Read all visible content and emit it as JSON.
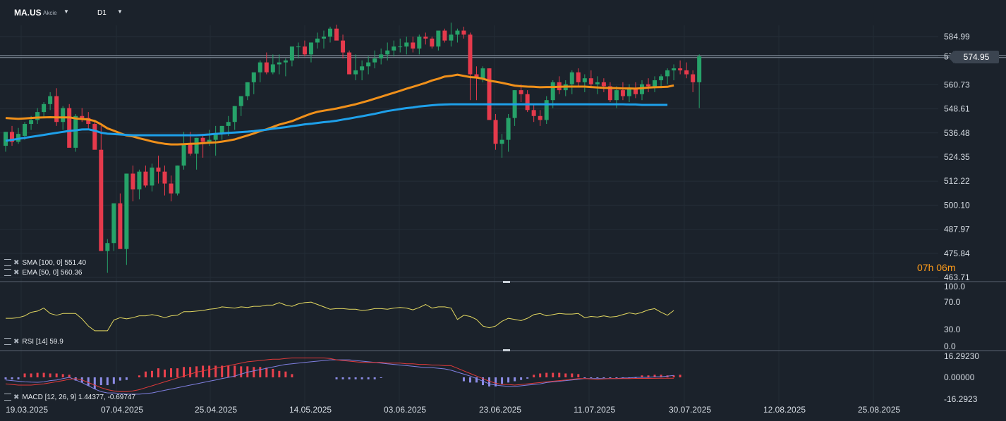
{
  "header": {
    "symbol": "MA.US",
    "symbol_type": "Akcie",
    "timeframe": "D1"
  },
  "indicators": {
    "sma": {
      "label": "SMA [100, 0]",
      "value": "551.40"
    },
    "ema": {
      "label": "EMA [50, 0]",
      "value": "560.36"
    },
    "rsi": {
      "label": "RSI [14]",
      "value": "59.9"
    },
    "macd": {
      "label": "MACD [12, 26, 9]",
      "value": "1.44377, -0.69747"
    }
  },
  "current_price": "574.95",
  "countdown": {
    "hours": "07",
    "h_unit": "h",
    "minutes": "06",
    "m_unit": "m"
  },
  "colors": {
    "background": "#1b222b",
    "up": "#26a269",
    "down": "#e53a4c",
    "sma": "#1ea0ea",
    "ema": "#f0901a",
    "rsi": "#e2d760",
    "macd": "#7f7fe0",
    "signal": "#e03a3a",
    "hist_pos": "#e8414d",
    "hist_neg": "#8c8ce6"
  },
  "chart_data": [
    {
      "type": "candlestick",
      "title": "MA.US D1",
      "ylim": [
        463.71,
        590
      ],
      "y_ticks": [
        "584.99",
        "574.95",
        "560.73",
        "548.61",
        "536.48",
        "524.35",
        "512.22",
        "500.10",
        "487.97",
        "475.84",
        "463.71"
      ],
      "x_ticks": [
        "19.03.2025",
        "07.04.2025",
        "25.04.2025",
        "14.05.2025",
        "03.06.2025",
        "23.06.2025",
        "11.07.2025",
        "30.07.2025",
        "12.08.2025",
        "25.08.2025"
      ],
      "candles_ohlc": [
        [
          530,
          537,
          527,
          537
        ],
        [
          537,
          540,
          530,
          532
        ],
        [
          532,
          539,
          531,
          536
        ],
        [
          535,
          542,
          533,
          541
        ],
        [
          541,
          545,
          538,
          543
        ],
        [
          543,
          549,
          541,
          547
        ],
        [
          547,
          552,
          544,
          551
        ],
        [
          551,
          557,
          548,
          555
        ],
        [
          555,
          559,
          540,
          542
        ],
        [
          542,
          550,
          538,
          549
        ],
        [
          549,
          551,
          535,
          529
        ],
        [
          529,
          546,
          527,
          545
        ],
        [
          545,
          549,
          542,
          544
        ],
        [
          544,
          547,
          538,
          541
        ],
        [
          541,
          543,
          530,
          528
        ],
        [
          528,
          540,
          513,
          477
        ],
        [
          477,
          483,
          466,
          481
        ],
        [
          481,
          498,
          477,
          501
        ],
        [
          501,
          506,
          490,
          478
        ],
        [
          478,
          516,
          470,
          516
        ],
        [
          516,
          520,
          502,
          508
        ],
        [
          508,
          518,
          503,
          517
        ],
        [
          517,
          520,
          509,
          510
        ],
        [
          510,
          521,
          507,
          519
        ],
        [
          519,
          525,
          511,
          517
        ],
        [
          517,
          520,
          505,
          511
        ],
        [
          511,
          515,
          502,
          506
        ],
        [
          506,
          520,
          505,
          520
        ],
        [
          520,
          537,
          518,
          531
        ],
        [
          531,
          537,
          525,
          526
        ],
        [
          526,
          534,
          518,
          534
        ],
        [
          534,
          536,
          524,
          532
        ],
        [
          532,
          538,
          530,
          533
        ],
        [
          533,
          540,
          525,
          536
        ],
        [
          536,
          540,
          533,
          540
        ],
        [
          540,
          545,
          535,
          542
        ],
        [
          542,
          550,
          538,
          550
        ],
        [
          550,
          555,
          545,
          555
        ],
        [
          555,
          562,
          553,
          562
        ],
        [
          562,
          566,
          556,
          567
        ],
        [
          567,
          573,
          562,
          572
        ],
        [
          572,
          577,
          566,
          567
        ],
        [
          567,
          576,
          566,
          571
        ],
        [
          571,
          576,
          566,
          572
        ],
        [
          572,
          574,
          565,
          573
        ],
        [
          573,
          578,
          570,
          580
        ],
        [
          580,
          582,
          574,
          580
        ],
        [
          580,
          583,
          575,
          576
        ],
        [
          576,
          582,
          572,
          582
        ],
        [
          582,
          587,
          579,
          584
        ],
        [
          584,
          588,
          579,
          585
        ],
        [
          585,
          590,
          582,
          589
        ],
        [
          589,
          591,
          584,
          583
        ],
        [
          583,
          586,
          574,
          577
        ],
        [
          577,
          578,
          567,
          566
        ],
        [
          566,
          576,
          563,
          568
        ],
        [
          568,
          573,
          563,
          570
        ],
        [
          570,
          575,
          566,
          572
        ],
        [
          572,
          578,
          569,
          574
        ],
        [
          574,
          579,
          571,
          576
        ],
        [
          576,
          582,
          573,
          578
        ],
        [
          578,
          583,
          575,
          580
        ],
        [
          580,
          584,
          577,
          580
        ],
        [
          580,
          585,
          576,
          582
        ],
        [
          582,
          585,
          577,
          579
        ],
        [
          579,
          586,
          576,
          585
        ],
        [
          585,
          587,
          581,
          584
        ],
        [
          584,
          585,
          579,
          580
        ],
        [
          580,
          588,
          578,
          588
        ],
        [
          588,
          589,
          582,
          583
        ],
        [
          583,
          592,
          580,
          586
        ],
        [
          586,
          589,
          582,
          588
        ],
        [
          588,
          590,
          584,
          586
        ],
        [
          586,
          587,
          553,
          566
        ],
        [
          566,
          570,
          553,
          564
        ],
        [
          564,
          570,
          562,
          569
        ],
        [
          569,
          569,
          549,
          543
        ],
        [
          543,
          546,
          528,
          531
        ],
        [
          531,
          536,
          524,
          533
        ],
        [
          533,
          546,
          527,
          544
        ],
        [
          544,
          558,
          540,
          558
        ],
        [
          558,
          561,
          552,
          556
        ],
        [
          556,
          558,
          547,
          548
        ],
        [
          548,
          551,
          542,
          545
        ],
        [
          545,
          548,
          540,
          543
        ],
        [
          543,
          555,
          541,
          553
        ],
        [
          553,
          563,
          549,
          562
        ],
        [
          562,
          565,
          556,
          558
        ],
        [
          558,
          563,
          555,
          561
        ],
        [
          561,
          568,
          556,
          567
        ],
        [
          567,
          569,
          560,
          562
        ],
        [
          562,
          566,
          557,
          564
        ],
        [
          564,
          568,
          559,
          561
        ],
        [
          561,
          565,
          556,
          562
        ],
        [
          562,
          564,
          557,
          560
        ],
        [
          560,
          562,
          552,
          553
        ],
        [
          553,
          560,
          549,
          558
        ],
        [
          558,
          562,
          553,
          555
        ],
        [
          555,
          561,
          552,
          559
        ],
        [
          559,
          562,
          554,
          556
        ],
        [
          556,
          563,
          553,
          561
        ],
        [
          561,
          564,
          557,
          560
        ],
        [
          560,
          565,
          557,
          563
        ],
        [
          563,
          566,
          559,
          565
        ],
        [
          565,
          569,
          561,
          568
        ],
        [
          568,
          571,
          563,
          569
        ],
        [
          569,
          573,
          566,
          568
        ],
        [
          568,
          572,
          564,
          566
        ],
        [
          566,
          568,
          557,
          562
        ],
        [
          562,
          576,
          549,
          575
        ]
      ],
      "sma_100": [
        532.5,
        533,
        533.5,
        534,
        534.5,
        535,
        535.5,
        536,
        536.5,
        537,
        537.5,
        537.8,
        538.2,
        538.3,
        537.6,
        536.6,
        536.1,
        535.9,
        535.7,
        535.5,
        535.3,
        535.3,
        535.3,
        535.3,
        535.3,
        535.3,
        535.3,
        535.3,
        535.3,
        535.3,
        535.3,
        535.5,
        535.7,
        536,
        536.2,
        536.5,
        536.7,
        536.9,
        537.1,
        537.4,
        537.8,
        538.1,
        538.6,
        539,
        539.4,
        539.9,
        540.3,
        540.8,
        541.1,
        541.5,
        541.9,
        542.2,
        542.6,
        543.2,
        543.7,
        544.3,
        544.9,
        545.5,
        546.1,
        546.8,
        547.5,
        548,
        548.5,
        549,
        549.3,
        549.8,
        550.1,
        550.4,
        550.7,
        550.8,
        550.9,
        550.9,
        550.9,
        550.9,
        550.9,
        550.9,
        550.9,
        550.9,
        550.9,
        550.9,
        550.9,
        550.9,
        550.9,
        550.9,
        550.9,
        550.9,
        550.9,
        550.9,
        550.9,
        550.9,
        550.9,
        550.9,
        550.9,
        550.9,
        550.9,
        550.9,
        550.9,
        550.9,
        550.8,
        550.8,
        550.6,
        550.6,
        550.6,
        550.6,
        550.6
      ],
      "ema_50": [
        544,
        543.8,
        543.6,
        543.8,
        544,
        544.2,
        544.3,
        544.4,
        544.3,
        544.3,
        544.3,
        543.8,
        543.5,
        543.2,
        542.5,
        540.8,
        538.8,
        537.6,
        536.3,
        535.2,
        534.7,
        533.8,
        533,
        532.2,
        531.5,
        531,
        530.7,
        530.7,
        530.8,
        531,
        531.1,
        531.3,
        531.6,
        531.7,
        532.1,
        532.6,
        533.2,
        534.2,
        535.2,
        536.2,
        537.4,
        538.3,
        539.5,
        540.7,
        541.5,
        542.4,
        543.7,
        545,
        546.2,
        547.1,
        547.7,
        548.2,
        548.8,
        549.5,
        550.2,
        550.9,
        551.8,
        552.7,
        553.7,
        554.7,
        555.7,
        556.7,
        557.7,
        558.8,
        559.7,
        560.7,
        561.7,
        562.9,
        563.8,
        564.9,
        565.2,
        565.8,
        565.2,
        564.6,
        564.4,
        563.8,
        562.8,
        562.3,
        561.7,
        561,
        560.3,
        560,
        559.8,
        559.7,
        559.5,
        559.6,
        559.6,
        559.7,
        559.8,
        559.8,
        559.8,
        559.8,
        559.6,
        559.4,
        559.2,
        559.1,
        559,
        558.9,
        558.9,
        558.8,
        559,
        559.3,
        559.5,
        559.6,
        559.7,
        560.4
      ]
    },
    {
      "type": "line",
      "title": "RSI [14]",
      "ylim": [
        0,
        100
      ],
      "y_ticks": [
        "100.0",
        "70.0",
        "30.0",
        "0.0"
      ],
      "rsi": [
        47,
        47,
        48,
        51,
        57,
        59,
        64,
        55,
        52,
        55,
        55,
        55,
        46,
        34,
        26,
        26,
        26,
        44,
        48,
        46,
        48,
        51,
        51,
        53,
        51,
        48,
        51,
        52,
        58,
        58,
        59,
        60,
        62,
        63,
        66,
        65,
        64,
        66,
        65,
        67,
        67,
        69,
        69,
        73,
        69,
        67,
        71,
        73,
        74,
        70,
        66,
        62,
        63,
        63,
        62,
        62,
        60,
        61,
        63,
        63,
        62,
        64,
        65,
        64,
        61,
        65,
        70,
        64,
        66,
        66,
        64,
        45,
        52,
        50,
        45,
        34,
        31,
        34,
        42,
        47,
        45,
        43,
        47,
        53,
        55,
        51,
        53,
        55,
        54,
        54,
        55,
        48,
        50,
        49,
        51,
        49,
        50,
        53,
        56,
        54,
        57,
        61,
        63,
        57,
        52,
        60
      ]
    },
    {
      "type": "bar",
      "title": "MACD [12, 26, 9]",
      "ylim": [
        -16.2923,
        16.2923
      ],
      "y_ticks": [
        "16.29230",
        "0.00000",
        "-16.2923"
      ],
      "macd": [
        -2,
        -2.5,
        -3,
        -3.5,
        -3.7,
        -3.8,
        -3.5,
        -2.5,
        -2,
        -1,
        0,
        -2,
        -4,
        -6.5,
        -9,
        -11,
        -12,
        -12,
        -12.5,
        -13,
        -13,
        -13,
        -12.5,
        -12,
        -11,
        -10,
        -9,
        -8,
        -7,
        -6,
        -5,
        -4,
        -3,
        -2,
        -1,
        0,
        1,
        2.5,
        4,
        5,
        6,
        7,
        8,
        9,
        10,
        10.5,
        11,
        11.5,
        12,
        12.5,
        13,
        13.5,
        13.5,
        13.5,
        13.5,
        13,
        12.5,
        12,
        11.5,
        11,
        10.5,
        10,
        9.5,
        9,
        8.5,
        8,
        7.5,
        7.5,
        7,
        6.5,
        5.5,
        4,
        2.5,
        1,
        -1,
        -3,
        -5,
        -6,
        -6.5,
        -7,
        -7,
        -6.5,
        -6,
        -5.5,
        -5,
        -4,
        -3.5,
        -3,
        -2.5,
        -2,
        -1.5,
        -1,
        -1,
        -1,
        -1,
        -1,
        -1,
        -0.5,
        -0.5,
        0,
        0,
        0,
        0.5,
        0.5,
        1,
        1.44377
      ],
      "signal": [
        -5,
        -5.5,
        -6,
        -6,
        -6,
        -5.5,
        -5,
        -4.2,
        -3.3,
        -2.5,
        -1.5,
        -1,
        -2,
        -4,
        -6,
        -8,
        -9.5,
        -10.5,
        -11,
        -11,
        -10.5,
        -9.5,
        -8,
        -6.5,
        -5,
        -3.5,
        -2,
        -0.5,
        1,
        2.5,
        4,
        5,
        6,
        7,
        8,
        9,
        10,
        11,
        12,
        12.5,
        13,
        13.5,
        14,
        14,
        14.5,
        15,
        15,
        15,
        15,
        15,
        15,
        14.5,
        13.5,
        13,
        12.5,
        12,
        11.5,
        11.5,
        11.5,
        11.5,
        11,
        11,
        11,
        10.5,
        10.5,
        10,
        10,
        9.5,
        9.5,
        9,
        9,
        7,
        5,
        3,
        1,
        -1,
        -3,
        -4.5,
        -5.5,
        -5.5,
        -6,
        -5.5,
        -5,
        -4.5,
        -4,
        -3.5,
        -3,
        -2.5,
        -2,
        -1.5,
        -1,
        -1,
        -1.2,
        -1.5,
        -1.2,
        -1,
        -1,
        -1,
        -0.9,
        -0.8,
        -0.8,
        -0.8,
        -0.75,
        -0.72,
        -0.7,
        -0.69747
      ],
      "histogram": [
        -1.5,
        -1.5,
        -1.5,
        3,
        3,
        3.5,
        3.5,
        3,
        3,
        2.5,
        2,
        -2.5,
        -4,
        -6.5,
        -9,
        -6,
        -6,
        -5,
        -2.5,
        -2,
        0,
        1.5,
        4.5,
        5,
        7,
        6,
        7,
        7,
        8,
        8,
        8.5,
        9,
        9,
        9,
        9,
        9,
        9,
        8.5,
        8.5,
        8,
        8,
        7.5,
        6.5,
        5,
        4.5,
        2.5,
        0,
        0,
        0,
        0,
        0,
        0,
        -1.5,
        -1.5,
        -1.5,
        -1.5,
        -1.5,
        -1.5,
        -1.5,
        -0.5,
        0,
        0,
        0,
        0,
        0,
        0,
        0,
        0,
        0,
        0,
        0,
        0,
        -3,
        -4,
        -4,
        -6,
        -7,
        -7,
        -5,
        -4,
        -3,
        -2,
        -1,
        2,
        3,
        3.5,
        3.5,
        3.5,
        3,
        3,
        2.5,
        -0.5,
        -0.5,
        -0.5,
        -0.5,
        -0.5,
        -0.5,
        -0.5,
        -0.5,
        -0.5,
        1.5,
        1.5,
        2,
        2,
        1.5,
        1.5,
        2
      ]
    }
  ]
}
